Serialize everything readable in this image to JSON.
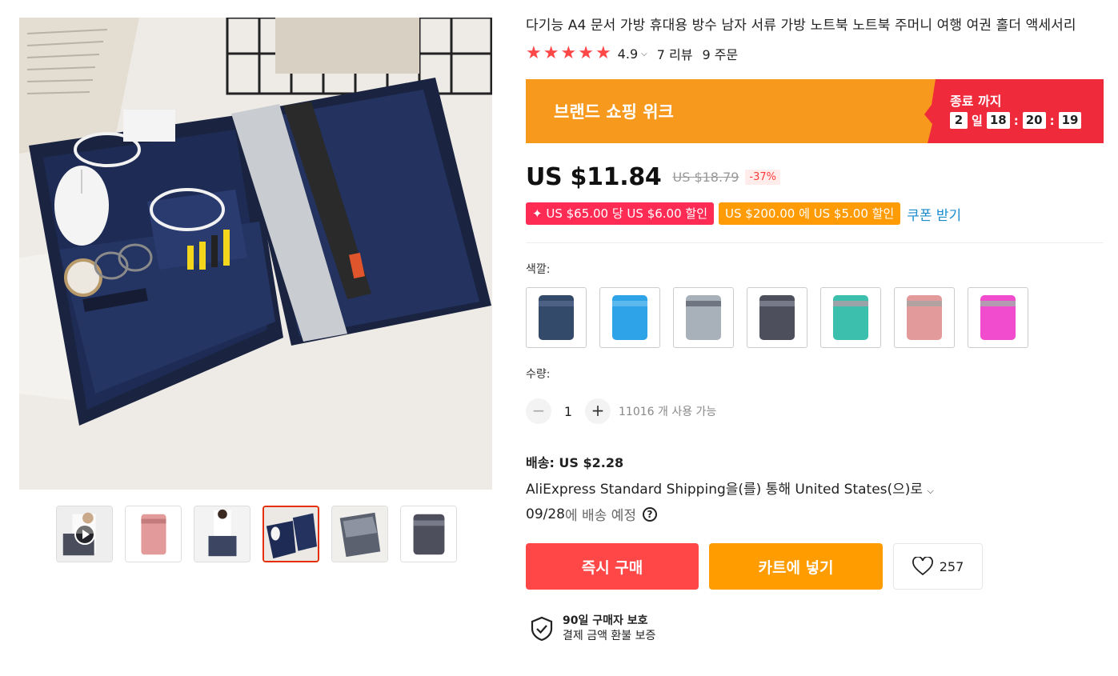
{
  "product": {
    "title": "다기능 A4 문서 가방 휴대용 방수 남자 서류 가방 노트북 노트북 주머니 여행 여권 홀더 액세서리",
    "rating": "4.9",
    "reviews": "7 리뷰",
    "orders": "9 주문"
  },
  "promo": {
    "name": "브랜드 쇼핑 위크",
    "ends_label": "종료 까지",
    "days": "2",
    "days_unit": "일",
    "hours": "18",
    "minutes": "20",
    "seconds": "19"
  },
  "price": {
    "current": "US $11.84",
    "original": "US $18.79",
    "discount": "-37%"
  },
  "coupons": {
    "coupon1": "✦ US $65.00 당 US $6.00 할인",
    "coupon2": "US $200.00 에 US $5.00 할인",
    "get_link": "쿠폰 받기"
  },
  "color": {
    "label": "색깔:",
    "options": [
      "navy",
      "sky-blue",
      "light-gray",
      "dark-gray",
      "teal",
      "pink",
      "magenta"
    ],
    "hex": [
      "#344a6b",
      "#2ea3e8",
      "#a8b0ba",
      "#4d4f5c",
      "#3dbfae",
      "#e39a9a",
      "#f04ccd"
    ]
  },
  "quantity": {
    "label": "수량:",
    "value": "1",
    "available": "11016 개 사용 가능"
  },
  "shipping": {
    "title": "배송: US $2.28",
    "method": "AliExpress Standard Shipping을(를) 통해 United States(으)로",
    "date": "09/28",
    "date_suffix": "에 배송 예정"
  },
  "actions": {
    "buy_now": "즉시 구매",
    "add_cart": "카트에 넣기",
    "wishlist_count": "257"
  },
  "protection": {
    "title": "90일 구매자 보호",
    "subtitle": "결제 금액 환불 보증"
  },
  "colors": {
    "accent_red": "#ff4747",
    "accent_orange": "#ff9c00",
    "promo_orange": "#f7991d",
    "promo_red": "#ef2a3b",
    "link_blue": "#1a8ccd"
  }
}
